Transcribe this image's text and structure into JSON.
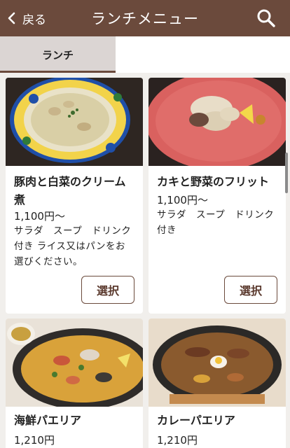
{
  "header": {
    "back_label": "戻る",
    "title": "ランチメニュー"
  },
  "tabs": [
    {
      "label": "ランチ",
      "active": true
    }
  ],
  "menu_items": [
    {
      "name": "豚肉と白菜のクリーム煮",
      "price": "1,100円〜",
      "description": "サラダ　スープ　ドリンク付き ライス又はパンをお選びください。",
      "button": "選択"
    },
    {
      "name": "カキと野菜のフリット",
      "price": "1,100円〜",
      "description": "サラダ　スープ　ドリンク付き",
      "button": "選択"
    },
    {
      "name": "海鮮パエリア",
      "price": "1,210円"
    },
    {
      "name": "カレーパエリア",
      "price": "1,210円"
    }
  ],
  "colors": {
    "header_bg": "#6b4a3c",
    "tab_active_bg": "#dbd5d3",
    "page_bg": "#f1efec"
  }
}
